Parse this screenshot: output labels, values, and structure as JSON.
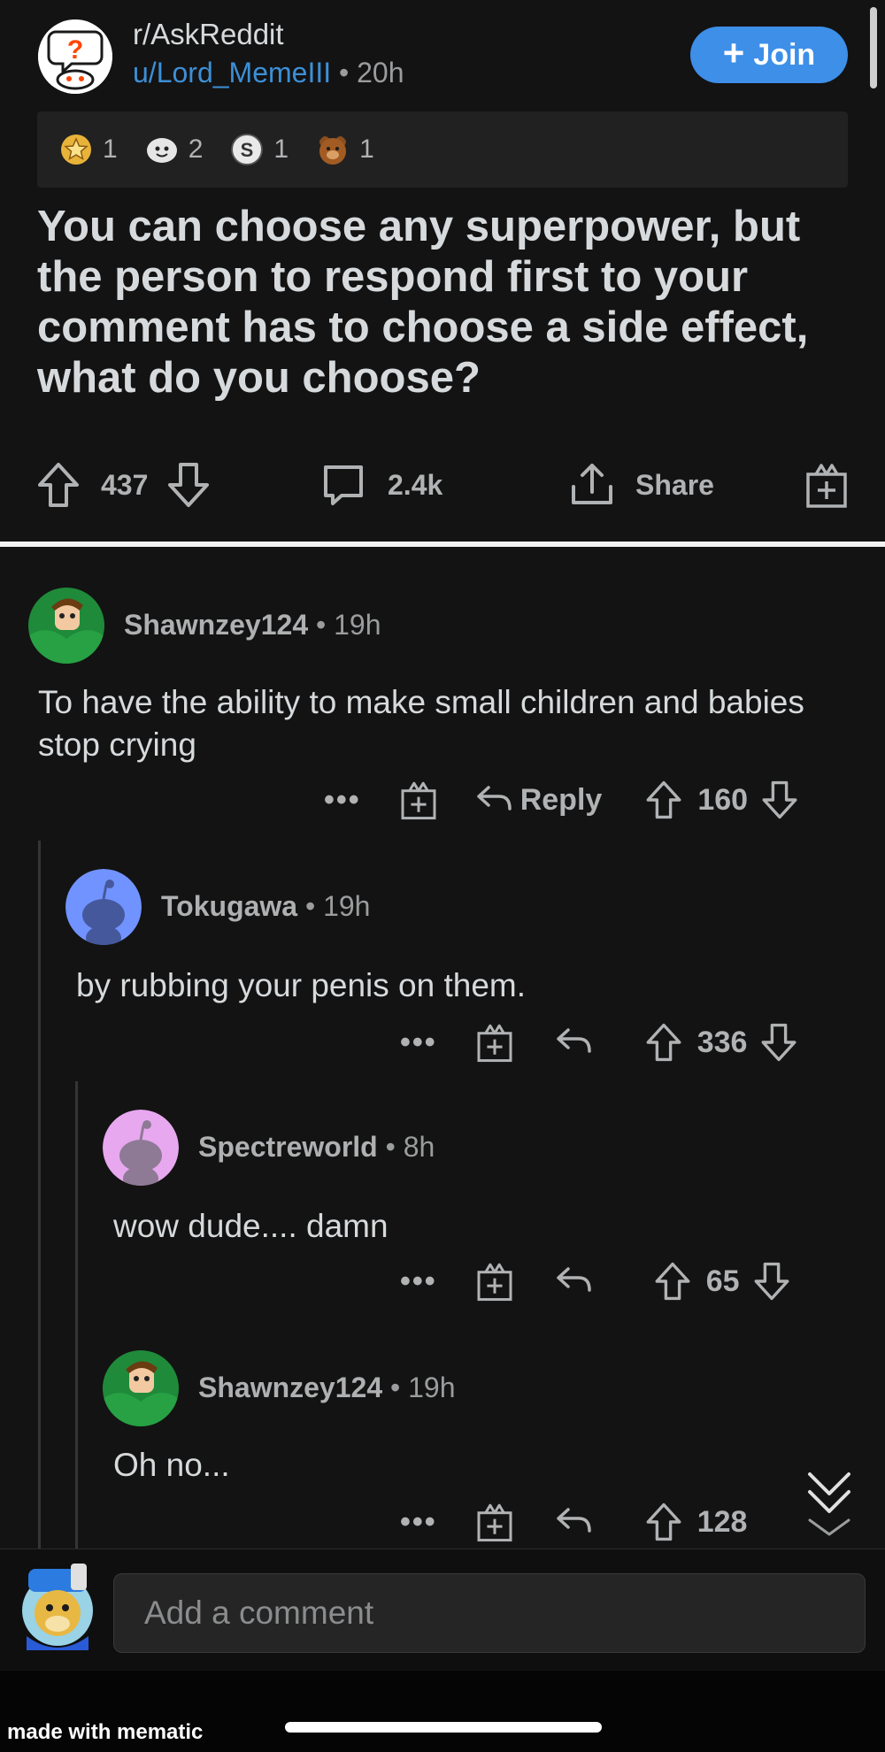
{
  "post": {
    "subreddit": "r/AskReddit",
    "author": "u/Lord_MemeIII",
    "time": "20h",
    "join_label": "Join",
    "awards": [
      {
        "icon": "gold-star-award-icon",
        "count": "1"
      },
      {
        "icon": "wholesome-award-icon",
        "count": "2"
      },
      {
        "icon": "silver-award-icon",
        "count": "1"
      },
      {
        "icon": "bear-award-icon",
        "count": "1"
      }
    ],
    "title": "You can choose any superpower, but the person to respond first to your comment has to choose a side effect, what do you choose?",
    "upvotes": "437",
    "comments": "2.4k",
    "share_label": "Share"
  },
  "comments": [
    {
      "author": "Shawnzey124",
      "time": "19h",
      "body": "To have the ability to make small children and babies stop crying",
      "votes": "160",
      "reply_label": "Reply",
      "dots": "•••"
    },
    {
      "author": "Tokugawa",
      "time": "19h",
      "body": "by rubbing your penis on them.",
      "votes": "336",
      "dots": "•••"
    },
    {
      "author": "Spectreworld",
      "time": "8h",
      "body": "wow dude.... damn",
      "votes": "65",
      "dots": "•••"
    },
    {
      "author": "Shawnzey124",
      "time": "19h",
      "body": "Oh no...",
      "votes": "128",
      "dots": "•••"
    }
  ],
  "composer": {
    "placeholder": "Add a comment"
  },
  "watermark": "made with mematic",
  "separator": "•"
}
